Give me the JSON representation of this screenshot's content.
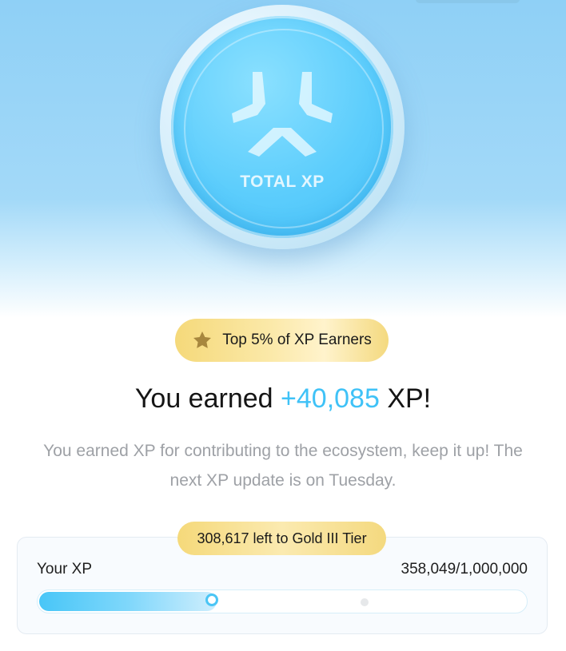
{
  "coin": {
    "label": "TOTAL XP",
    "logo_icon": "xp-logo-icon"
  },
  "badge": {
    "icon": "star-icon",
    "text": "Top 5% of XP Earners"
  },
  "headline": {
    "prefix": "You earned",
    "amount": "+40,085",
    "suffix": "XP!"
  },
  "subtext": {
    "line1": "You earned XP for contributing to the ecosystem, keep it up! The",
    "line2": "next XP update is on Tuesday."
  },
  "progress": {
    "tier_text": "308,617 left to Gold III Tier",
    "label": "Your XP",
    "value_text": "358,049/1,000,000",
    "current": 358049,
    "total": 1000000,
    "next_tier_fraction": 0.6667
  },
  "colors": {
    "accent": "#3fc2f7",
    "gold": "#f5d97a",
    "text_muted": "#9ea1a6"
  }
}
